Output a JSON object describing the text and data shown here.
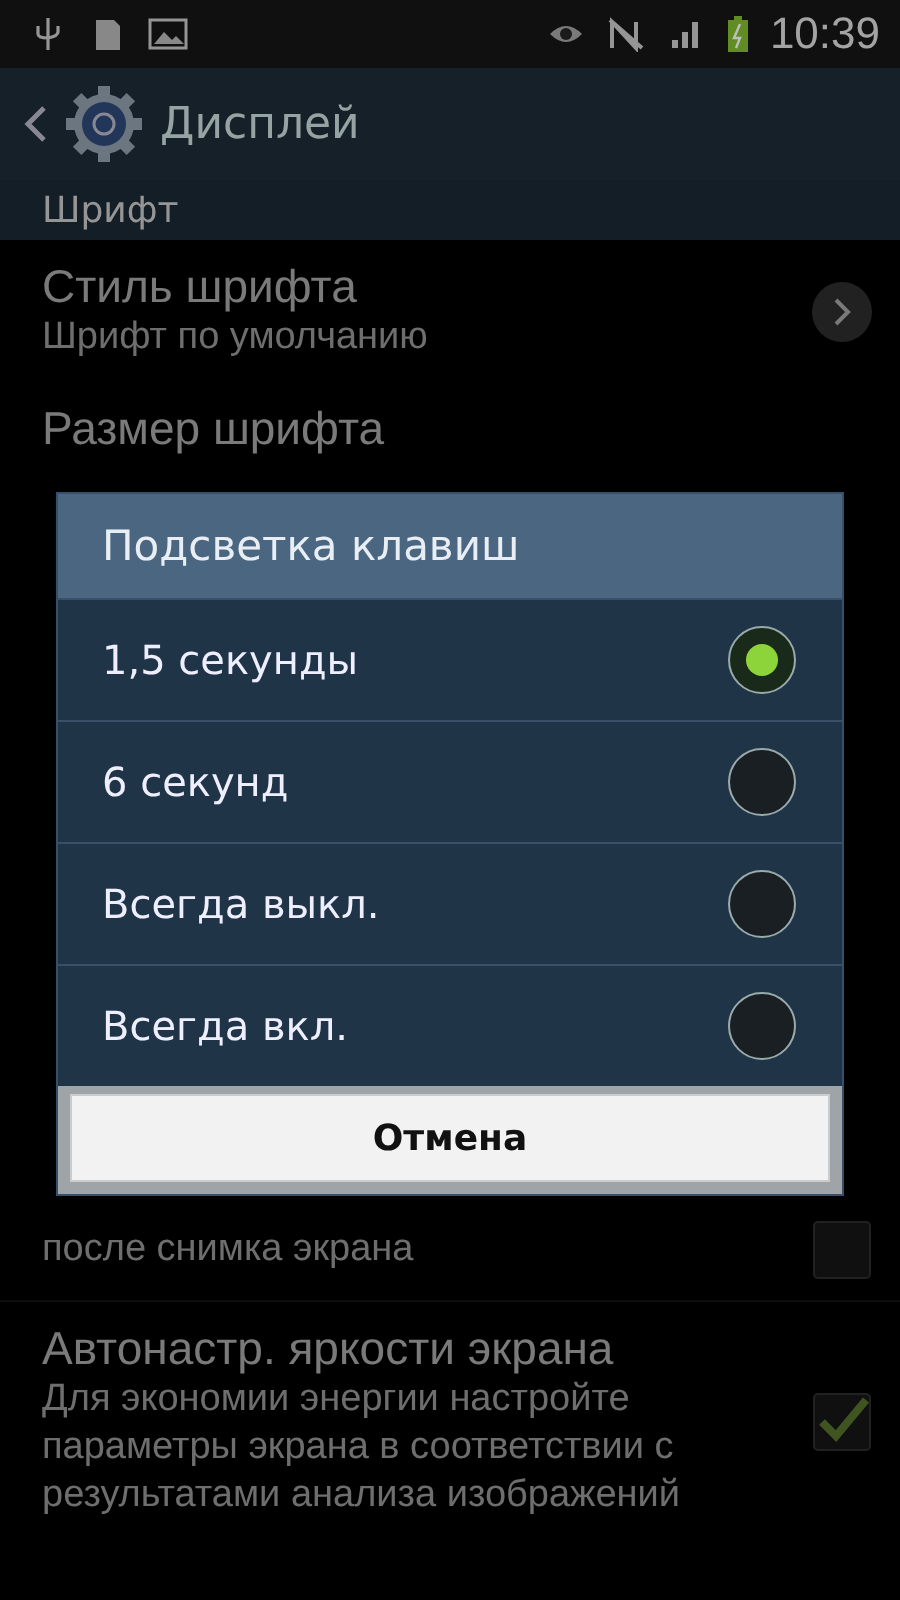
{
  "status_bar": {
    "time": "10:39"
  },
  "action_bar": {
    "title": "Дисплей"
  },
  "section": {
    "title": "Шрифт"
  },
  "top_items": [
    {
      "kind": "link",
      "title": "Стиль шрифта",
      "summary": "Шрифт по умолчанию"
    },
    {
      "kind": "plain",
      "title": "Размер шрифта"
    }
  ],
  "bottom_items": [
    {
      "kind": "checkbox",
      "summary": "после снимка экрана",
      "checked": false
    },
    {
      "kind": "checkbox",
      "title": "Автонастр. яркости экрана",
      "summary": "Для экономии энергии настройте параметры экрана в соответствии с результатами анализа изображений",
      "checked": true
    }
  ],
  "dialog": {
    "title": "Подсветка клавиш",
    "options": [
      {
        "label": "1,5 секунды",
        "selected": true
      },
      {
        "label": "6 секунд",
        "selected": false
      },
      {
        "label": "Всегда выкл.",
        "selected": false
      },
      {
        "label": "Всегда вкл.",
        "selected": false
      }
    ],
    "cancel": "Отмена"
  }
}
